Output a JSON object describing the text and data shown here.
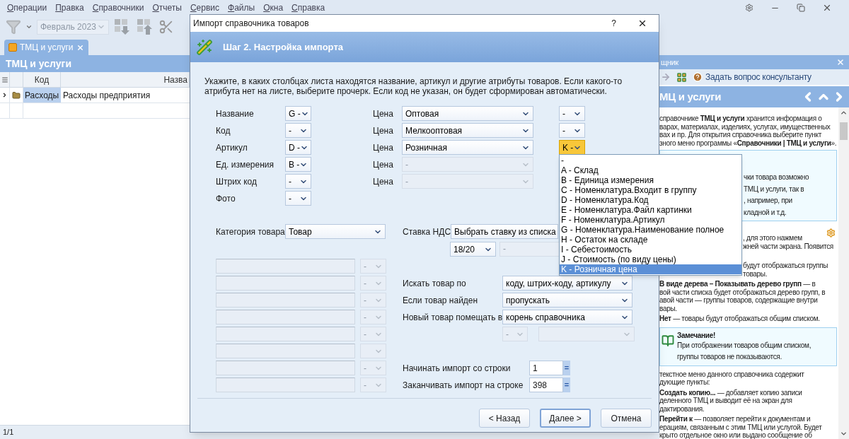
{
  "menu": [
    "Операции",
    "Правка",
    "Справочники",
    "Отчеты",
    "Сервис",
    "Файлы",
    "Окна",
    "Справка"
  ],
  "toolbar": {
    "period": "Февраль 2023"
  },
  "tab": {
    "label": "ТМЦ и услуги",
    "selected": true
  },
  "list": {
    "title": "ТМЦ и услуги",
    "columns": [
      "Код",
      "Назва"
    ],
    "rows": [
      {
        "code": "Расходы",
        "name": "Расходы предприятия",
        "selected": true,
        "expanded": false
      }
    ]
  },
  "status_bar": "1/1",
  "help": {
    "title": "щник",
    "ask": "Задать вопрос консультанту",
    "topic": "МЦ и услуги",
    "blocks": [
      {
        "kind": "text",
        "lines": [
          {
            "text": "справочнике **ТМЦ и услуги** хранится информация о",
            "partial": false
          },
          {
            "text": "варах, материалах, изделиях, услугах, имущественных",
            "partial": false
          },
          {
            "text": "вах и пр. Для открытия справочника выберите пункт",
            "partial": false
          },
          {
            "text": "зного меню программы «**Справочники | ТМЦ и услуги**».",
            "partial": false
          }
        ]
      },
      {
        "kind": "box",
        "lines": [
          {
            "text": "чки товара возможно",
            "partial": true
          },
          {
            "text": "ТМЦ и услуги, так в",
            "partial": true
          },
          {
            "text": ",     например,     при",
            "partial": true
          },
          {
            "text": "кладной и т.д.",
            "partial": true
          }
        ]
      },
      {
        "kind": "gear",
        "lines": [
          {
            "text": ",   для   этого   нажмем",
            "partial": true
          },
          {
            "text": "жней части экрана. Появится",
            "partial": true
          }
        ]
      },
      {
        "kind": "text",
        "lines": [
          {
            "text": "будут   отображаться   группы",
            "partial": true
          },
          {
            "text": "товары.",
            "partial": true
          }
        ]
      },
      {
        "kind": "text",
        "lines": [
          {
            "text": "**В виде дерева – Показывать дерево групп** — в",
            "partial": false
          },
          {
            "text": "вой части списка будет отображаться дерево групп, в",
            "partial": false
          },
          {
            "text": "авой части — группы товаров, содержащие внутри",
            "partial": false
          },
          {
            "text": "вары.",
            "partial": false
          }
        ]
      },
      {
        "kind": "text",
        "lines": [
          {
            "text": "**Нет** — товары будут отображаться общим списком.",
            "partial": false
          }
        ]
      },
      {
        "kind": "note",
        "title": "Замечание!",
        "lines": [
          {
            "text": "При отображении товаров общим списком,",
            "partial": false
          },
          {
            "text": "группы товаров не показываются.",
            "partial": false
          }
        ]
      },
      {
        "kind": "text",
        "lines": [
          {
            "text": "текстное меню данного справочника содержит",
            "partial": false
          },
          {
            "text": "дующие пункты:",
            "partial": false
          }
        ]
      },
      {
        "kind": "text",
        "lines": [
          {
            "text": "**Создать копию...** — добавляет копию записи",
            "partial": false
          },
          {
            "text": "деленного ТМЦ и выводит её на экран для",
            "partial": false
          },
          {
            "text": "дактирования.",
            "partial": false
          }
        ]
      },
      {
        "kind": "text",
        "lines": [
          {
            "text": "**Перейти к** — позволяет перейти к документам и",
            "partial": false
          },
          {
            "text": "ерациям, связанным с этим ТМЦ или услугой. Будет",
            "partial": false
          },
          {
            "text": "крыто отдельное окно или выдано сообщение об",
            "partial": false
          }
        ]
      }
    ]
  },
  "dialog": {
    "title": "Импорт справочника товаров",
    "help": "?",
    "step": "Шаг 2. Настройка импорта",
    "intro": "Укажите, в каких столбцах листа находятся название, артикул и другие атрибуты товаров. Если какого-то атрибута нет на листе, выберите прочерк. Если код не указан, он будет сформирован автоматически.",
    "attributes": [
      {
        "label": "Название",
        "value": "G -"
      },
      {
        "label": "Код",
        "value": "-"
      },
      {
        "label": "Артикул",
        "value": "D -"
      },
      {
        "label": "Ед. измерения",
        "value": "B -"
      },
      {
        "label": "Штрих код",
        "value": "-"
      },
      {
        "label": "Фото",
        "value": "-"
      }
    ],
    "prices": [
      {
        "label": "Цена",
        "value": "Оптовая",
        "disabled": false,
        "column": "-",
        "focused": false
      },
      {
        "label": "Цена",
        "value": "Мелкооптовая",
        "disabled": false,
        "column": "-",
        "focused": false
      },
      {
        "label": "Цена",
        "value": "Розничная",
        "disabled": false,
        "column": "K -",
        "focused": true
      },
      {
        "label": "Цена",
        "value": "-",
        "disabled": true
      },
      {
        "label": "Цена",
        "value": "-",
        "disabled": true
      }
    ],
    "category": {
      "label": "Категория товара",
      "value": "Товар"
    },
    "vat": {
      "label": "Ставка НДС",
      "value": "Выбрать ставку из списка",
      "rate": "18/20",
      "extra": "-"
    },
    "extra_fields": [
      {
        "value": "-",
        "disabled": true
      },
      {
        "value": "-",
        "disabled": true
      },
      {
        "value": "-",
        "disabled": true
      },
      {
        "value": "-",
        "disabled": true
      },
      {
        "value": "-",
        "disabled": true
      },
      {
        "disabled": true
      },
      {
        "value": "-",
        "disabled": true
      },
      {
        "value": "-",
        "disabled": true
      }
    ],
    "options": [
      {
        "label": "Искать товар по",
        "value": "коду, штрих-коду, артикулу"
      },
      {
        "label": "Если товар найден",
        "value": "пропускать"
      },
      {
        "label": "Новый товар помещать в",
        "value": "корень справочника"
      }
    ],
    "parent": {
      "column": "-",
      "disabled": true
    },
    "rows": [
      {
        "label": "Начинать импорт со строки",
        "value": "1",
        "button": "="
      },
      {
        "label": "Заканчивать импорт на строке",
        "value": "398",
        "button": "="
      }
    ],
    "buttons": [
      {
        "label": "< Назад",
        "default": false
      },
      {
        "label": "Далее >",
        "default": true
      },
      {
        "label": "Отмена",
        "default": false
      }
    ]
  },
  "dropdown": {
    "items": [
      {
        "label": "-",
        "selected": false
      },
      {
        "label": "A - Склад",
        "selected": false
      },
      {
        "label": "B - Единица измерения",
        "selected": false
      },
      {
        "label": "C - Номенклатура.Входит в группу",
        "selected": false
      },
      {
        "label": "D - Номенклатура.Код",
        "selected": false
      },
      {
        "label": "E - Номенклатура.Файл картинки",
        "selected": false
      },
      {
        "label": "F - Номенклатура.Артикул",
        "selected": false
      },
      {
        "label": "G - Номенклатура.Наименование полное",
        "selected": false
      },
      {
        "label": "H - Остаток на складе",
        "selected": false
      },
      {
        "label": "I - Себестоимость",
        "selected": false
      },
      {
        "label": "J - Стоимость (по виду цены)",
        "selected": false
      },
      {
        "label": "K - Розничная цена",
        "selected": true
      }
    ]
  }
}
